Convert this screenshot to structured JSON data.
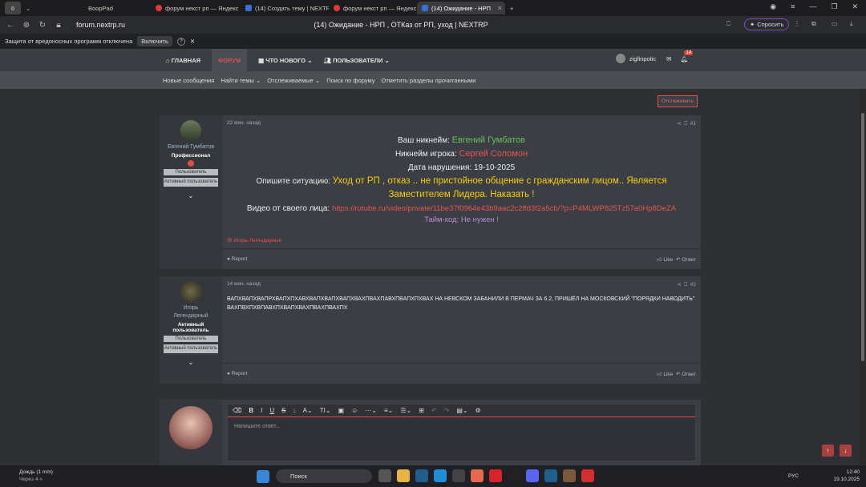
{
  "browser": {
    "tabs": [
      {
        "label": "BoopPad",
        "active": false
      },
      {
        "label": "форум некст рп — Яндекс",
        "active": false
      },
      {
        "label": "(14) Создать тему | NEXTRP",
        "active": false
      },
      {
        "label": "форум некст рп — Яндекс",
        "active": false
      },
      {
        "label": "(14) Ожидание - НРП",
        "active": true
      }
    ],
    "tab_counter": "6",
    "url": "forum.nextrp.ru",
    "page_title": "(14) Ожидание - НРП , ОТКаз от РП, уход | NEXTRP",
    "ask_button": "Спросить",
    "infobar_text": "Защита от вредоносных программ отключена",
    "infobar_button": "Включить",
    "infobar_help": "?"
  },
  "forum": {
    "nav": {
      "home": "ГЛАВНАЯ",
      "forum": "ФОРУМ",
      "whats_new": "ЧТО НОВОГО",
      "users": "ПОЛЬЗОВАТЕЛИ",
      "username": "zigfinpotic",
      "alerts_count": "14"
    },
    "subnav": [
      "Новые сообщения",
      "Найти темы",
      "Отслеживаемые",
      "Поиск по форуму",
      "Отметить разделы прочитанными"
    ],
    "watch_button": "Отслеживать",
    "posts": [
      {
        "author": "Евгений Гумбатов",
        "title": "Профессионал",
        "badges": [
          "Пользователь",
          "Активный пользователь"
        ],
        "time": "22 мин. назад",
        "number": "#1",
        "nick_label": "Ваш никнейм:",
        "nick_value": "Евгений Гумбатов",
        "player_label": "Никнейм игрока:",
        "player_value": "Сергей Соломон",
        "date_line": "Дата нарушения: 19-10-2025",
        "situation_label": "Опишите ситуацию:",
        "situation_value": "Уход от РП , отказ .. не пристойное общение с гражданским лицом.. Является Заместителем Лидера. Наказать !",
        "video_label": "Видео от своего лица:",
        "video_link": "https://rutube.ru/video/private/11be37f0964e43b9aac2c2ffd3f2a5cb/?p=P4MLWP825Tz57a0Hp8DeZA",
        "timecode": "Тайм-код: Не нужен !",
        "reaction": "Игорь Легендарный",
        "report": "Report",
        "like": "Like",
        "reply": "Ответ"
      },
      {
        "author": "Игорь Легендарный",
        "title": "Активный пользователь",
        "badges": [
          "Пользователь",
          "Активный пользователь"
        ],
        "time": "14 мин. назад",
        "number": "#2",
        "message": "ВАПХВАПХВАПРХВАПХПХАВХВАПХВАПХВАПХВАХПВАХПАВХПВАПХПХВАХ НА НЕВСКОМ ЗАБАНИЛИ В ПЕРМАЧ ЗА 6.2, ПРИШЁЛ НА МОСКОВСКИЙ \"ПОРЯДКИ НАВОДИТЬ\" ВАХПВХПХВПАВХПХВАПХВАХПВАХПВАХПХ",
        "report": "Report",
        "like": "Like",
        "reply": "Ответ"
      }
    ],
    "editor_placeholder": "Напишите ответ..."
  },
  "taskbar": {
    "weather_title": "Дождь (1 mm)",
    "weather_sub": "Через 4 ч",
    "search": "Поиск",
    "lang": "РУС",
    "time": "12:40",
    "date": "19.10.2025"
  }
}
